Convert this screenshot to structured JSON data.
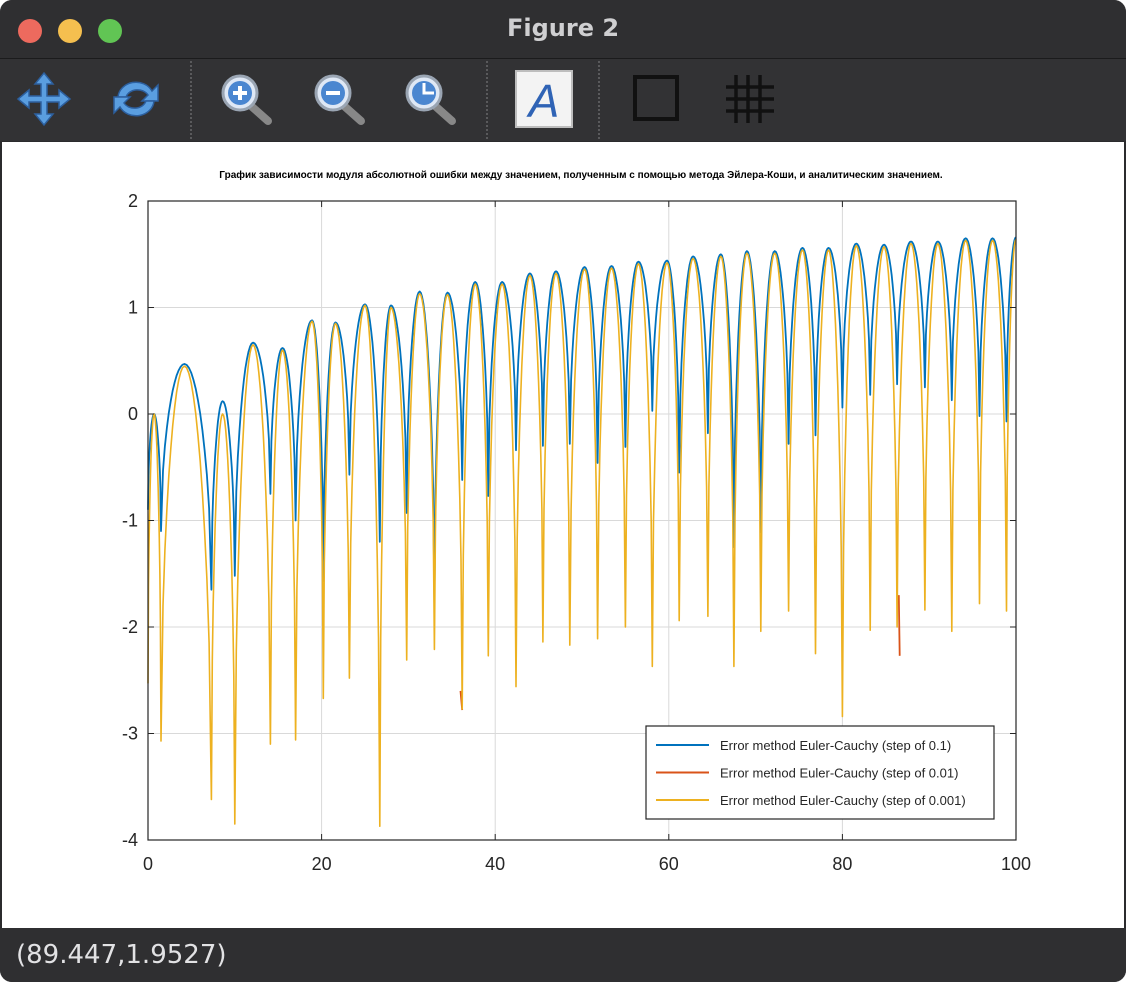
{
  "window": {
    "title": "Figure 2"
  },
  "toolbar": {
    "tools": [
      "pan-icon",
      "rotate-icon",
      "zoom-in-icon",
      "zoom-out-icon",
      "zoom-reset-icon",
      "insert-text-icon",
      "axes-box-icon",
      "grid-icon"
    ]
  },
  "status": {
    "coordinates": "(89.447,1.9527)"
  },
  "colors": {
    "series1": "#0072bd",
    "series2": "#d95319",
    "series3": "#edb120",
    "grid": "#d9d9d9"
  },
  "chart_data": {
    "type": "line",
    "title": "График зависимости модуля абсолютной ошибки между значением, полученным с помощью метода Эйлера-Коши, и аналитическим значением.",
    "xlabel": "",
    "ylabel": "",
    "xlim": [
      0,
      100
    ],
    "ylim": [
      -4,
      2
    ],
    "xticks": [
      "0",
      "20",
      "40",
      "60",
      "80",
      "100"
    ],
    "yticks": [
      "2",
      "1",
      "0",
      "-1",
      "-2",
      "-3",
      "-4"
    ],
    "grid": true,
    "legend_position": "bottom-right",
    "series": [
      {
        "name": "Error method Euler-Cauchy (step of 0.1)",
        "color": "#0072bd",
        "x": [
          0,
          0.7,
          1.5,
          4.2,
          7.3,
          8.6,
          10.0,
          12.1,
          14.1,
          15.5,
          17.0,
          18.9,
          20.2,
          21.6,
          23.2,
          25.0,
          26.7,
          28.0,
          29.8,
          31.3,
          33.0,
          34.5,
          36.2,
          37.7,
          39.2,
          40.8,
          42.4,
          44.0,
          45.5,
          47.0,
          48.6,
          50.3,
          51.8,
          53.4,
          55.0,
          56.5,
          58.1,
          59.8,
          61.2,
          62.8,
          64.5,
          66.0,
          67.5,
          69.0,
          70.6,
          72.2,
          73.8,
          75.4,
          76.9,
          78.4,
          80.0,
          81.6,
          83.2,
          84.8,
          86.3,
          87.9,
          89.5,
          91.0,
          92.6,
          94.2,
          95.8,
          97.3,
          98.9,
          100
        ],
        "y": [
          -0.9,
          0.0,
          -1.1,
          0.47,
          -1.65,
          0.12,
          -1.52,
          0.67,
          -0.75,
          0.62,
          -1.0,
          0.88,
          -1.57,
          0.86,
          -0.57,
          1.03,
          -1.2,
          1.02,
          -0.93,
          1.15,
          -1.77,
          1.14,
          -0.62,
          1.24,
          -0.77,
          1.24,
          -0.34,
          1.32,
          -0.3,
          1.34,
          -0.28,
          1.38,
          -0.46,
          1.39,
          -0.31,
          1.43,
          0.03,
          1.44,
          -0.55,
          1.48,
          -0.18,
          1.5,
          -1.25,
          1.53,
          -1.11,
          1.53,
          -0.28,
          1.56,
          -0.2,
          1.56,
          0.06,
          1.6,
          0.18,
          1.59,
          0.28,
          1.62,
          0.25,
          1.62,
          0.13,
          1.65,
          -0.02,
          1.65,
          -0.07,
          1.66
        ]
      },
      {
        "name": "Error method Euler-Cauchy (step of 0.01)",
        "color": "#d95319",
        "x": [
          36.0,
          36.2,
          86.5,
          86.6
        ],
        "y": [
          -2.6,
          -2.78,
          -1.7,
          -2.27
        ]
      },
      {
        "name": "Error method Euler-Cauchy (step of 0.001)",
        "color": "#edb120",
        "x": [
          0,
          0.7,
          1.5,
          4.2,
          7.3,
          8.6,
          10.0,
          12.1,
          14.1,
          15.5,
          17.0,
          18.9,
          20.2,
          21.6,
          23.2,
          25.0,
          26.7,
          28.0,
          29.8,
          31.3,
          33.0,
          34.5,
          36.2,
          37.7,
          39.2,
          40.8,
          42.4,
          44.0,
          45.5,
          47.0,
          48.6,
          50.3,
          51.8,
          53.4,
          55.0,
          56.5,
          58.1,
          59.8,
          61.2,
          62.8,
          64.5,
          66.0,
          67.5,
          69.0,
          70.6,
          72.2,
          73.8,
          75.4,
          76.9,
          78.4,
          80.0,
          81.6,
          83.2,
          84.8,
          86.3,
          87.9,
          89.5,
          91.0,
          92.6,
          94.2,
          95.8,
          97.3,
          98.9,
          100
        ],
        "y": [
          -2.53,
          0.0,
          -3.07,
          0.45,
          -3.62,
          0.0,
          -3.85,
          0.65,
          -3.1,
          0.6,
          -3.06,
          0.87,
          -2.67,
          0.85,
          -2.48,
          1.02,
          -3.87,
          1.0,
          -2.31,
          1.13,
          -2.21,
          1.12,
          -2.77,
          1.22,
          -2.27,
          1.22,
          -2.56,
          1.3,
          -2.14,
          1.32,
          -2.17,
          1.36,
          -2.11,
          1.37,
          -2.0,
          1.41,
          -2.37,
          1.42,
          -1.94,
          1.46,
          -1.9,
          1.48,
          -2.37,
          1.51,
          -2.04,
          1.51,
          -1.85,
          1.54,
          -2.25,
          1.54,
          -2.84,
          1.58,
          -2.03,
          1.57,
          -2.0,
          1.6,
          -1.84,
          1.6,
          -2.04,
          1.63,
          -1.78,
          1.63,
          -1.85,
          1.64
        ]
      }
    ]
  }
}
